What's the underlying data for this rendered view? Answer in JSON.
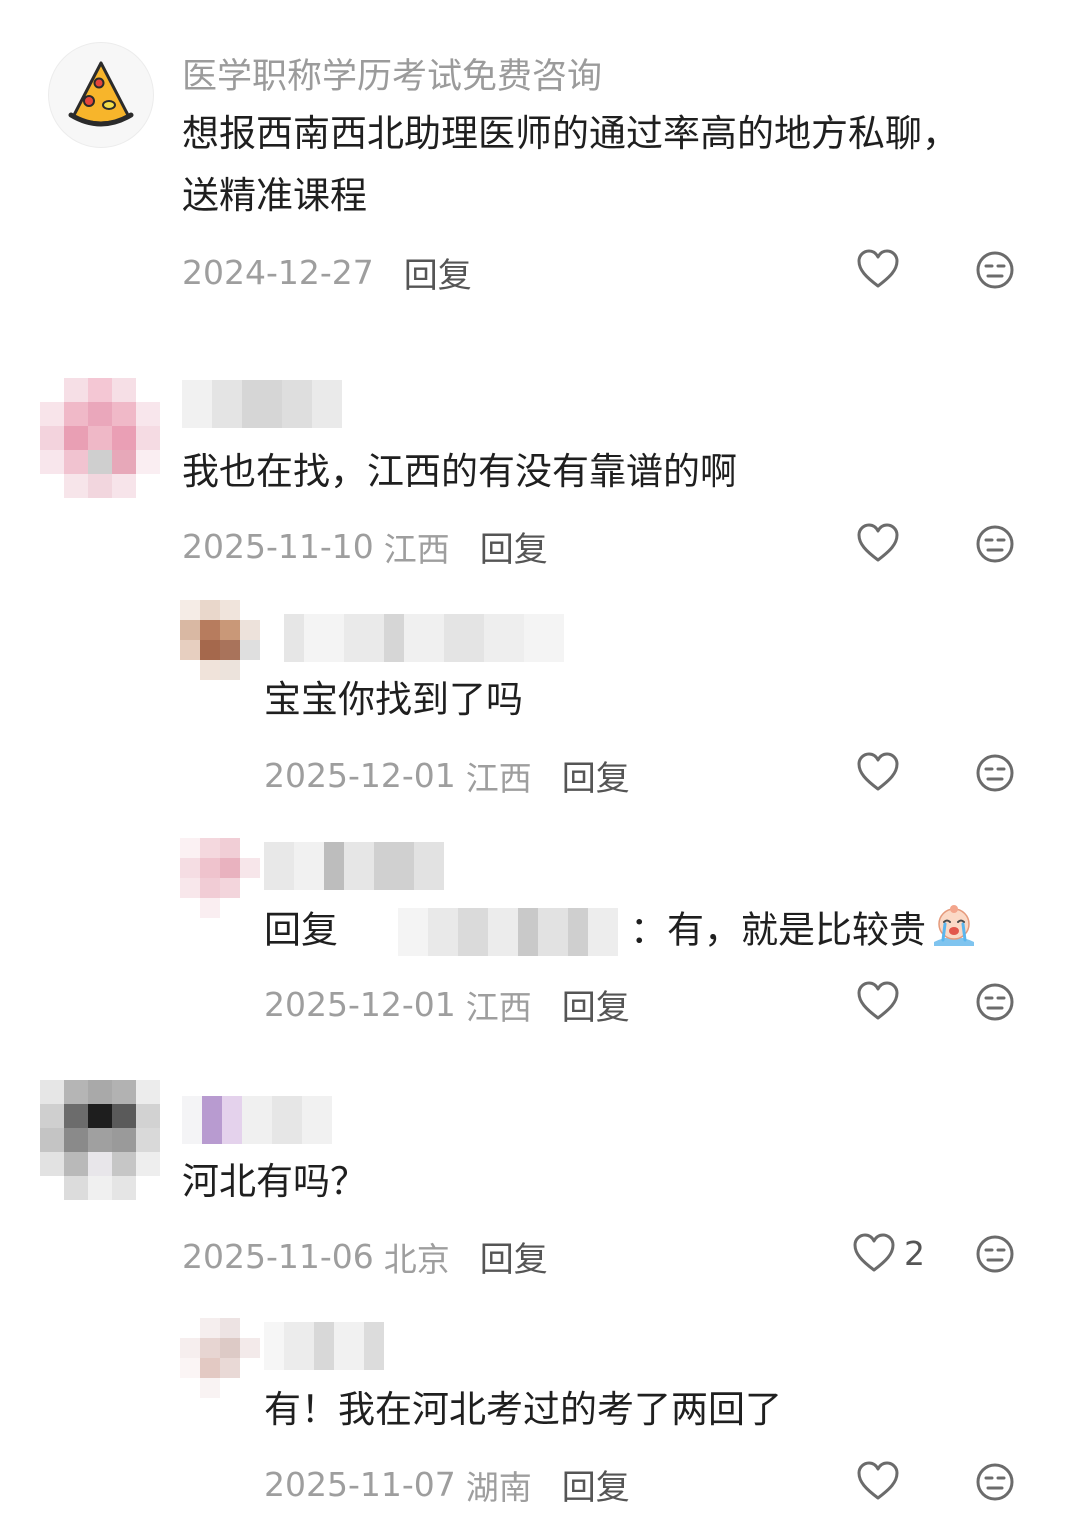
{
  "comments": [
    {
      "id": "c1",
      "username": "医学职称学历考试免费咨询",
      "text_line1": "想报西南西北助理医师的通过率高的地方私聊，",
      "text_line2": "送精准课程",
      "date": "2024-12-27",
      "location": "",
      "reply_label": "回复",
      "avatar_icon": "pizza-icon"
    },
    {
      "id": "c2",
      "username": "",
      "text": "我也在找，江西的有没有靠谱的啊",
      "date": "2025-11-10",
      "location": "江西",
      "reply_label": "回复"
    },
    {
      "id": "c2r1",
      "username": "",
      "text": "宝宝你找到了吗",
      "date": "2025-12-01",
      "location": "江西",
      "reply_label": "回复"
    },
    {
      "id": "c2r2",
      "username": "",
      "reply_prefix": "回复",
      "text": "：有，就是比较贵",
      "emoji_icon": "crying-emoji-icon",
      "date": "2025-12-01",
      "location": "江西",
      "reply_label": "回复"
    },
    {
      "id": "c3",
      "username": "",
      "text": "河北有吗？",
      "date": "2025-11-06",
      "location": "北京",
      "reply_label": "回复",
      "like_count": "2"
    },
    {
      "id": "c3r1",
      "username": "",
      "text": "有！我在河北考过的考了两回了",
      "date": "2025-11-07",
      "location": "湖南",
      "reply_label": "回复"
    }
  ],
  "colors": {
    "text": "#1f1f1f",
    "meta": "#9e9e9e",
    "username": "#9b9b9b",
    "icon_stroke": "#6b6b6b"
  }
}
